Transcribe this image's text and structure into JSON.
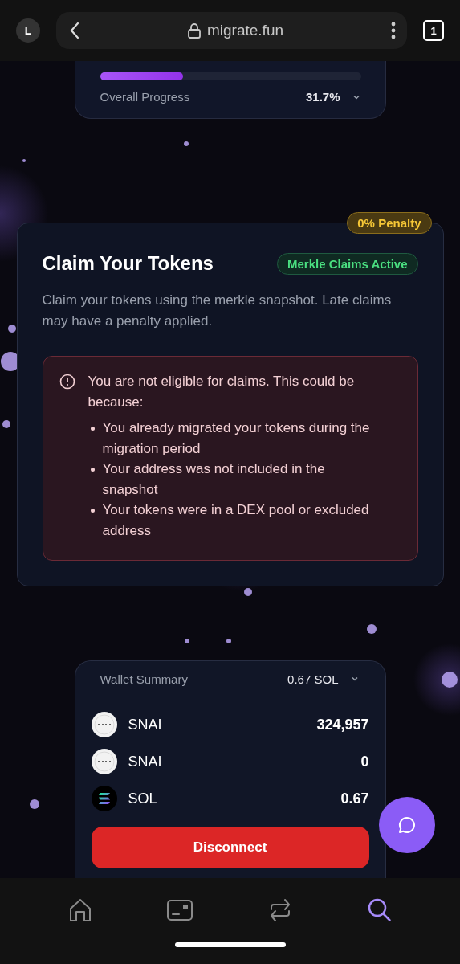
{
  "browser": {
    "avatar": "L",
    "url": "migrate.fun",
    "tab_count": "1"
  },
  "progress": {
    "level": 0.317,
    "label": "Overall Progress",
    "value": "31.7%"
  },
  "claim": {
    "penalty": "0% Penalty",
    "title": "Claim Your Tokens",
    "status": "Merkle Claims Active",
    "description": "Claim your tokens using the merkle snapshot. Late claims may have a penalty applied.",
    "alert": {
      "message": "You are not eligible for claims. This could be because:",
      "reasons": [
        "You already migrated your tokens during the migration period",
        "Your address was not included in the snapshot",
        "Your tokens were in a DEX pool or excluded address"
      ]
    }
  },
  "wallet": {
    "title": "Wallet Summary",
    "balance": "0.67 SOL",
    "tokens": [
      {
        "kind": "snai",
        "name": "SNAI",
        "amount": "324,957"
      },
      {
        "kind": "snai",
        "name": "SNAI",
        "amount": "0"
      },
      {
        "kind": "sol",
        "name": "SOL",
        "amount": "0.67"
      }
    ],
    "button": "Disconnect"
  },
  "nav": [
    {
      "kind": "home",
      "selected": false
    },
    {
      "kind": "wallet",
      "selected": false
    },
    {
      "kind": "swap",
      "selected": false
    },
    {
      "kind": "search",
      "selected": true
    }
  ]
}
